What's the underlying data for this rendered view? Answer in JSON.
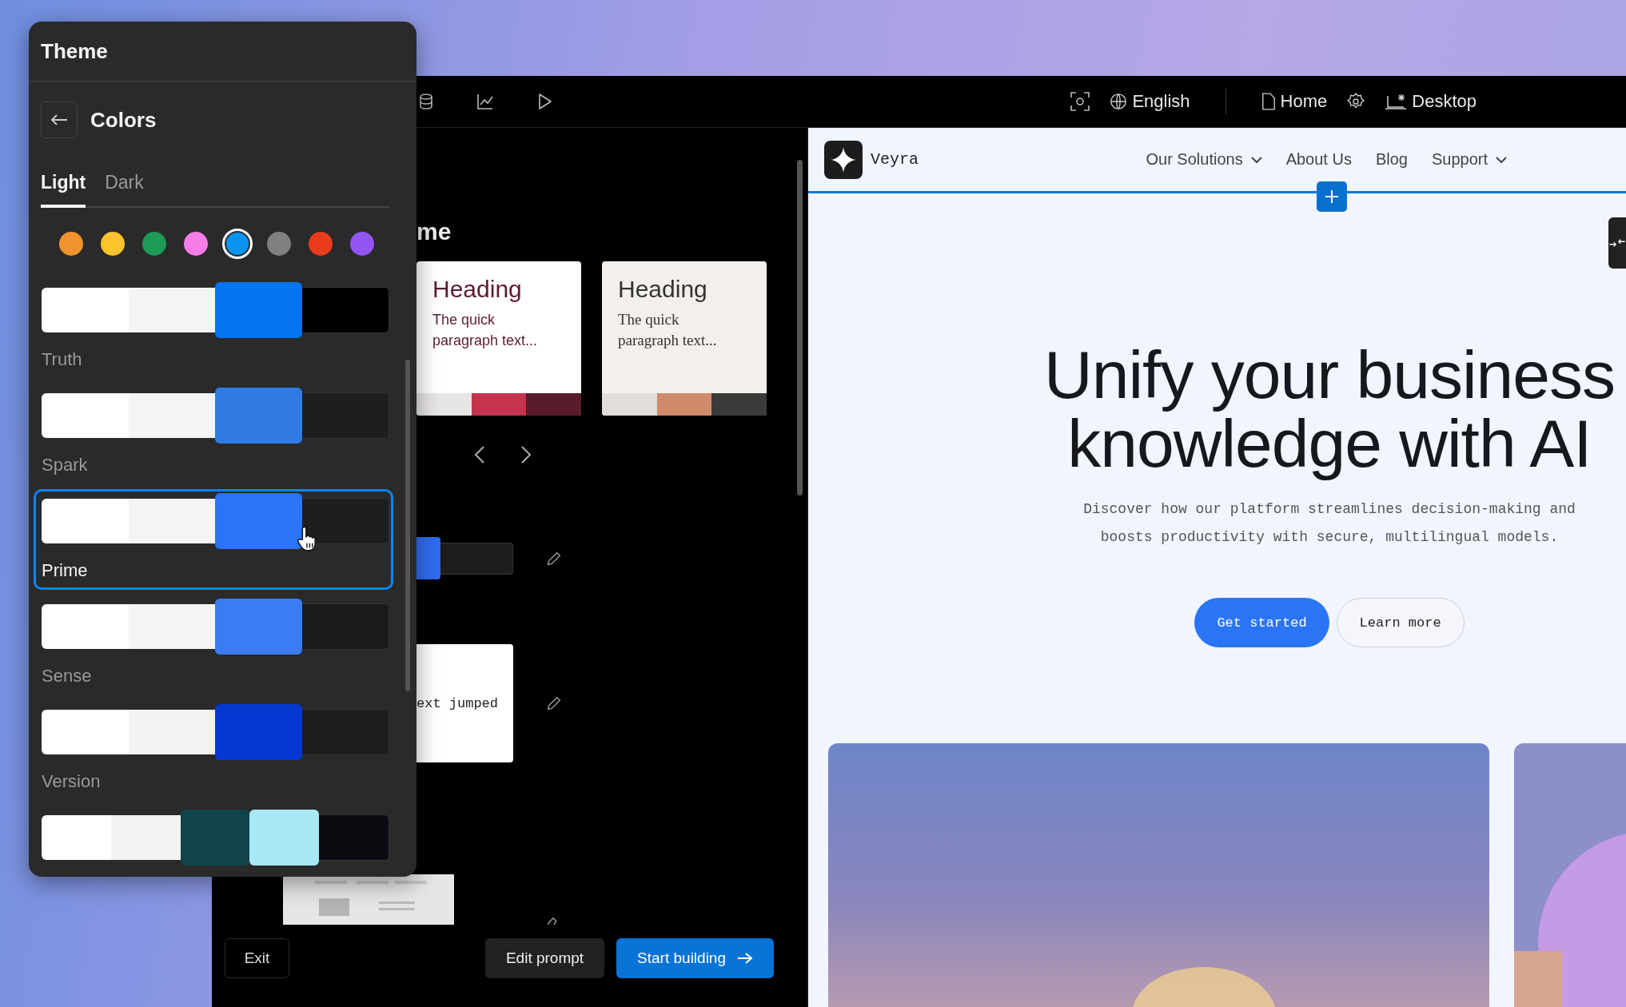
{
  "theme_panel": {
    "title": "Theme",
    "section": "Colors",
    "tabs": [
      {
        "label": "Light",
        "selected": true
      },
      {
        "label": "Dark",
        "selected": false
      }
    ],
    "swatches": [
      {
        "color": "#f0922e",
        "selected": false
      },
      {
        "color": "#fcc42c",
        "selected": false
      },
      {
        "color": "#1e9a56",
        "selected": false
      },
      {
        "color": "#f77de8",
        "selected": false
      },
      {
        "color": "#0994f2",
        "selected": true
      },
      {
        "color": "#808080",
        "selected": false
      },
      {
        "color": "#e83c1c",
        "selected": false
      },
      {
        "color": "#9355f2",
        "selected": false
      }
    ],
    "palettes": [
      {
        "name": "Truth",
        "selected": false,
        "colors": [
          {
            "color": "#ffffff",
            "accent": false
          },
          {
            "color": "#f3f4f5",
            "accent": false
          },
          {
            "color": "#0474f0",
            "accent": true
          },
          {
            "color": "#000000",
            "accent": false
          }
        ]
      },
      {
        "name": "Spark",
        "selected": false,
        "colors": [
          {
            "color": "#ffffff",
            "accent": false
          },
          {
            "color": "#f4f5f6",
            "accent": false
          },
          {
            "color": "#2f7be3",
            "accent": true
          },
          {
            "color": "#1e1e1e",
            "accent": false
          }
        ]
      },
      {
        "name": "Prime",
        "selected": true,
        "colors": [
          {
            "color": "#ffffff",
            "accent": false
          },
          {
            "color": "#f4f4f4",
            "accent": false
          },
          {
            "color": "#2b74f7",
            "accent": true
          },
          {
            "color": "#1e1e1e",
            "accent": false
          }
        ]
      },
      {
        "name": "Sense",
        "selected": false,
        "colors": [
          {
            "color": "#ffffff",
            "accent": false
          },
          {
            "color": "#f6f5f3",
            "accent": false
          },
          {
            "color": "#3c7cf2",
            "accent": true
          },
          {
            "color": "#1b1a1a",
            "accent": false
          }
        ]
      },
      {
        "name": "Version",
        "selected": false,
        "colors": [
          {
            "color": "#ffffff",
            "accent": false
          },
          {
            "color": "#f3f3f3",
            "accent": false
          },
          {
            "color": "#0537d1",
            "accent": true
          },
          {
            "color": "#1e1e1e",
            "accent": false
          }
        ]
      },
      {
        "colors": [
          {
            "color": "#ffffff",
            "accent": false
          },
          {
            "color": "#f3f3f3",
            "accent": false
          },
          {
            "color": "#10444a",
            "accent": true
          },
          {
            "color": "#a6e8f4",
            "accent": true
          },
          {
            "color": "#0b0b12",
            "accent": false
          }
        ]
      }
    ]
  },
  "toolbar": {
    "language": "English",
    "page": "Home",
    "device": "Desktop"
  },
  "editor": {
    "heading": "me",
    "font_cards": [
      {
        "heading": "Heading",
        "text": "The quick paragraph text...",
        "kind": "sans",
        "color": "#5c1a30",
        "background": {
          "color": "#ffffff"
        },
        "strip": [
          {
            "color": "#e8e5e5"
          },
          {
            "color": "#c4344f"
          },
          {
            "color": "#581c2b"
          }
        ]
      },
      {
        "heading": "Heading",
        "text": "The quick paragraph text...",
        "kind": "serif",
        "color": "#333333",
        "background": {
          "color": "#f3f0ec"
        },
        "strip": [
          {
            "color": "#e2ddd8"
          },
          {
            "color": "#cf8a6a"
          },
          {
            "color": "#3a3b39"
          }
        ]
      }
    ],
    "sample_text": "ext jumped",
    "exit": "Exit",
    "edit_prompt": "Edit prompt",
    "start_building": "Start building"
  },
  "preview": {
    "brand": "Veyra",
    "nav": [
      {
        "label": "Our Solutions",
        "dropdown": true
      },
      {
        "label": "About Us",
        "dropdown": false
      },
      {
        "label": "Blog",
        "dropdown": false
      },
      {
        "label": "Support",
        "dropdown": true
      }
    ],
    "hero": {
      "title": [
        "Unify your business",
        "knowledge with AI"
      ],
      "description": [
        "Discover how our platform streamlines decision-making and",
        "boosts productivity with secure, multilingual models."
      ],
      "primary": "Get started",
      "secondary": "Learn more"
    }
  }
}
